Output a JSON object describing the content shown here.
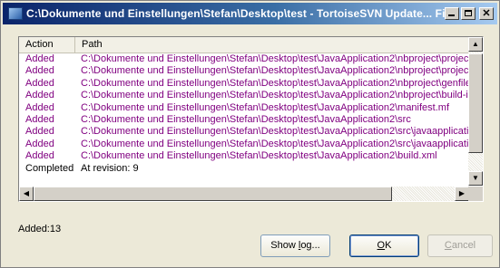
{
  "window": {
    "title": "C:\\Dokumente und Einstellungen\\Stefan\\Desktop\\test - TortoiseSVN Update... Fini...",
    "icon": "tortoisesvn-icon"
  },
  "list": {
    "columns": {
      "action": "Action",
      "path": "Path"
    },
    "rows": [
      {
        "action": "Added",
        "path": "C:\\Dokumente und Einstellungen\\Stefan\\Desktop\\test\\JavaApplication2\\nbproject\\project.p",
        "status": "added"
      },
      {
        "action": "Added",
        "path": "C:\\Dokumente und Einstellungen\\Stefan\\Desktop\\test\\JavaApplication2\\nbproject\\project.x",
        "status": "added"
      },
      {
        "action": "Added",
        "path": "C:\\Dokumente und Einstellungen\\Stefan\\Desktop\\test\\JavaApplication2\\nbproject\\genfiles.",
        "status": "added"
      },
      {
        "action": "Added",
        "path": "C:\\Dokumente und Einstellungen\\Stefan\\Desktop\\test\\JavaApplication2\\nbproject\\build-imp",
        "status": "added"
      },
      {
        "action": "Added",
        "path": "C:\\Dokumente und Einstellungen\\Stefan\\Desktop\\test\\JavaApplication2\\manifest.mf",
        "status": "added"
      },
      {
        "action": "Added",
        "path": "C:\\Dokumente und Einstellungen\\Stefan\\Desktop\\test\\JavaApplication2\\src",
        "status": "added"
      },
      {
        "action": "Added",
        "path": "C:\\Dokumente und Einstellungen\\Stefan\\Desktop\\test\\JavaApplication2\\src\\javaapplication",
        "status": "added"
      },
      {
        "action": "Added",
        "path": "C:\\Dokumente und Einstellungen\\Stefan\\Desktop\\test\\JavaApplication2\\src\\javaapplication",
        "status": "added"
      },
      {
        "action": "Added",
        "path": "C:\\Dokumente und Einstellungen\\Stefan\\Desktop\\test\\JavaApplication2\\build.xml",
        "status": "added"
      },
      {
        "action": "Completed",
        "path": "At revision: 9",
        "status": "done"
      }
    ]
  },
  "summary": {
    "text": "Added:13"
  },
  "buttons": {
    "show_log": {
      "pre": "Show ",
      "key": "l",
      "post": "og..."
    },
    "ok": {
      "pre": "",
      "key": "O",
      "post": "K"
    },
    "cancel": {
      "pre": "",
      "key": "C",
      "post": "ancel"
    }
  },
  "colors": {
    "added": "#800080",
    "completed": "#000000",
    "titlebar": "#0a246a"
  }
}
